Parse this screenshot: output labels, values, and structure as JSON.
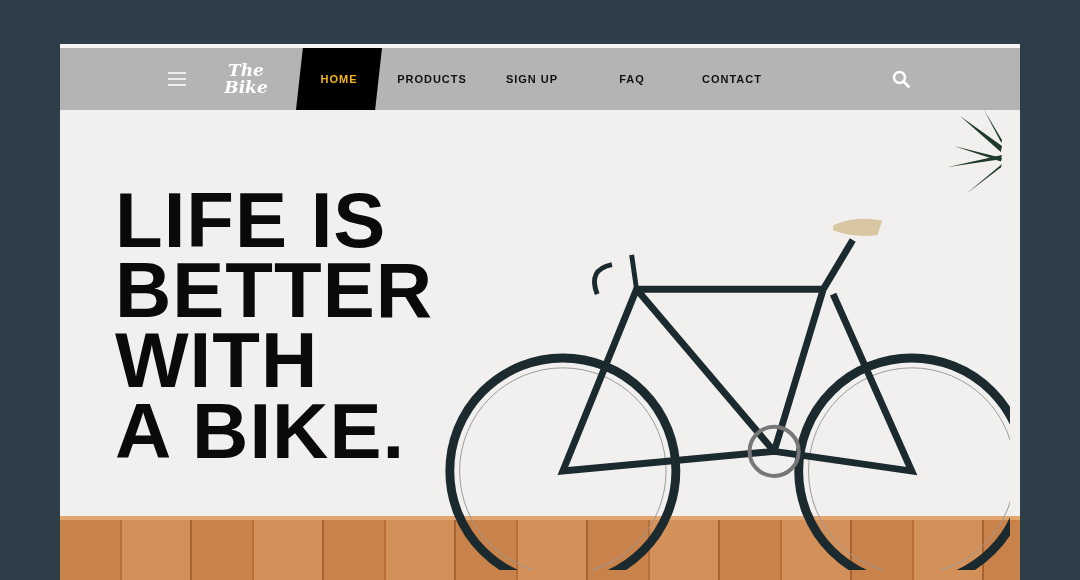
{
  "navbar": {
    "logo": "The Bike",
    "items": [
      {
        "label": "HOME",
        "selected": true
      },
      {
        "label": "PRODUCTS",
        "selected": false
      },
      {
        "label": "SIGN UP",
        "selected": false
      },
      {
        "label": "FAQ",
        "selected": false
      },
      {
        "label": "CONTACT",
        "selected": false
      }
    ]
  },
  "hero": {
    "headline": "LIFE IS\nBETTER\nWITH\nA BIKE."
  }
}
